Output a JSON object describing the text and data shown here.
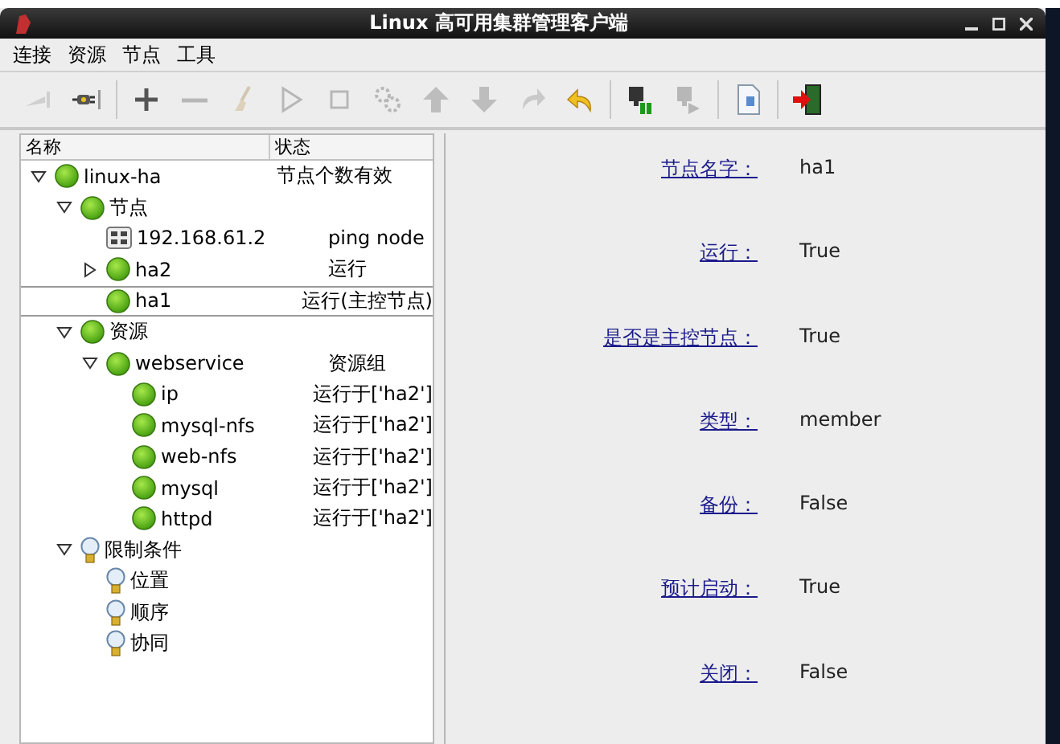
{
  "window": {
    "title": "Linux 高可用集群管理客户端"
  },
  "menu": [
    "连接",
    "资源",
    "节点",
    "工具"
  ],
  "toolbar": [
    [
      {
        "kind": "disconnect",
        "disabled": true
      },
      {
        "kind": "connect",
        "disabled": false
      }
    ],
    [
      {
        "kind": "add",
        "disabled": false
      },
      {
        "kind": "remove",
        "disabled": true
      },
      {
        "kind": "clean",
        "disabled": true
      },
      {
        "kind": "start",
        "disabled": true
      },
      {
        "kind": "stop",
        "disabled": true
      },
      {
        "kind": "settings",
        "disabled": true
      },
      {
        "kind": "up",
        "disabled": true
      },
      {
        "kind": "down",
        "disabled": true
      },
      {
        "kind": "redo",
        "disabled": true
      },
      {
        "kind": "undo",
        "disabled": false
      }
    ],
    [
      {
        "kind": "standby",
        "disabled": false
      },
      {
        "kind": "online",
        "disabled": true
      }
    ],
    [
      {
        "kind": "document",
        "disabled": false
      }
    ],
    [
      {
        "kind": "exit",
        "disabled": false
      }
    ]
  ],
  "tree": {
    "columns": [
      "名称",
      "状态"
    ],
    "items": [
      {
        "kind": "status",
        "name": "linux-ha",
        "status": "节点个数有效",
        "selected": false,
        "expanded": true,
        "children": [
          {
            "kind": "status",
            "name": "节点",
            "selected": false,
            "expanded": true,
            "children": [
              {
                "kind": "ip",
                "name": "192.168.61.2",
                "status": "ping node",
                "selected": false
              },
              {
                "kind": "status",
                "name": "ha2",
                "status": "运行",
                "selected": false,
                "expanded": false
              },
              {
                "kind": "status",
                "name": "ha1",
                "status": "运行(主控节点)",
                "selected": true
              }
            ]
          },
          {
            "kind": "status",
            "name": "资源",
            "selected": false,
            "expanded": true,
            "children": [
              {
                "kind": "status",
                "name": "webservice",
                "status": "资源组",
                "selected": false,
                "expanded": true,
                "children": [
                  {
                    "kind": "status",
                    "name": "ip",
                    "status": "运行于['ha2']",
                    "selected": false
                  },
                  {
                    "kind": "status",
                    "name": "mysql-nfs",
                    "status": "运行于['ha2']",
                    "selected": false
                  },
                  {
                    "kind": "status",
                    "name": "web-nfs",
                    "status": "运行于['ha2']",
                    "selected": false
                  },
                  {
                    "kind": "status",
                    "name": "mysql",
                    "status": "运行于['ha2']",
                    "selected": false
                  },
                  {
                    "kind": "status",
                    "name": "httpd",
                    "status": "运行于['ha2']",
                    "selected": false
                  }
                ]
              }
            ]
          },
          {
            "kind": "constraint",
            "name": "限制条件",
            "selected": false,
            "expanded": true,
            "children": [
              {
                "kind": "constraint",
                "name": "位置",
                "selected": false
              },
              {
                "kind": "constraint",
                "name": "顺序",
                "selected": false
              },
              {
                "kind": "constraint",
                "name": "协同",
                "selected": false
              }
            ]
          }
        ]
      }
    ]
  },
  "details": [
    {
      "label": "节点名字：",
      "value": "ha1"
    },
    {
      "label": "运行：",
      "value": "True"
    },
    {
      "label": "是否是主控节点：",
      "value": "True"
    },
    {
      "label": "类型：",
      "value": "member"
    },
    {
      "label": "备份：",
      "value": "False"
    },
    {
      "label": "预计启动：",
      "value": "True"
    },
    {
      "label": "关闭：",
      "value": "False"
    }
  ]
}
